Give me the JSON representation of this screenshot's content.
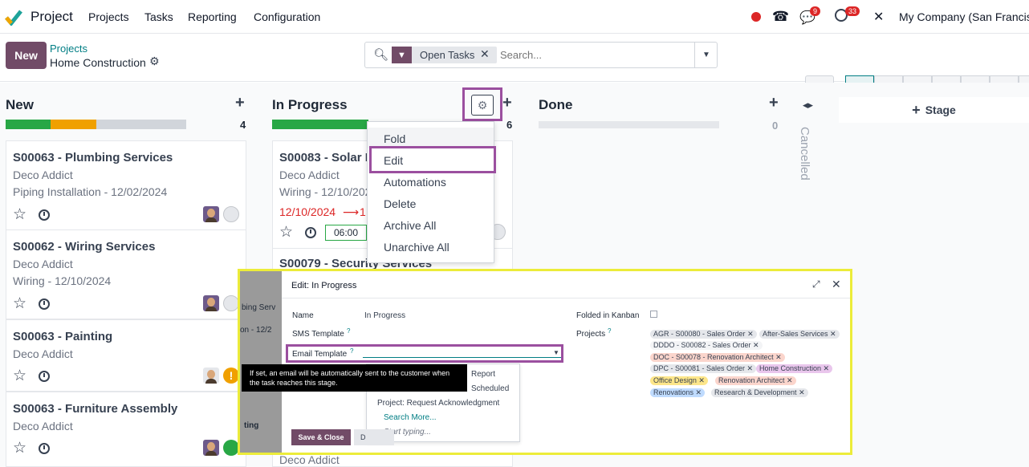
{
  "nav": {
    "app_name": "Project",
    "menu": [
      "Projects",
      "Tasks",
      "Reporting",
      "Configuration"
    ],
    "chat_count": "9",
    "activity_count": "33",
    "company": "My Company (San Francisco)"
  },
  "control_panel": {
    "new_label": "New",
    "breadcrumb_parent": "Projects",
    "breadcrumb_current": "Home Construction",
    "filter_facet": "Open Tasks",
    "search_placeholder": "Search..."
  },
  "columns": [
    {
      "name": "New",
      "count": "4"
    },
    {
      "name": "In Progress",
      "count": "6"
    },
    {
      "name": "Done",
      "count": "0"
    },
    {
      "name": "Cancelled"
    }
  ],
  "add_stage_label": "Stage",
  "new_cards": [
    {
      "title": "S00063 - Plumbing Services",
      "customer": "Deco Addict",
      "detail": "Piping Installation - 12/02/2024"
    },
    {
      "title": "S00062 - Wiring Services",
      "customer": "Deco Addict",
      "detail": "Wiring - 12/10/2024"
    },
    {
      "title": "S00063 - Painting",
      "customer": "Deco Addict",
      "detail": ""
    },
    {
      "title": "S00063 - Furniture Assembly",
      "customer": "Deco Addict",
      "detail": ""
    }
  ],
  "progress_cards": [
    {
      "title": "S00083 - Solar In",
      "customer": "Deco Addict",
      "detail": "Wiring - 12/10/202",
      "date_from": "12/10/2024",
      "arrow": "⟶",
      "date_to": "1",
      "time": "06:00"
    },
    {
      "title": "S00079 - Security Services",
      "customer": "Deco Addict"
    }
  ],
  "stage_menu": [
    "Fold",
    "Edit",
    "Automations",
    "Delete",
    "Archive All",
    "Unarchive All"
  ],
  "dialog": {
    "title": "Edit: In Progress",
    "name_label": "Name",
    "name_value": "In Progress",
    "sms_label": "SMS Template",
    "email_label": "Email Template",
    "folded_label": "Folded in Kanban",
    "projects_label": "Projects",
    "tooltip": "If set, an email will be automatically sent to the customer when the task reaches this stage.",
    "dropdown": [
      "Report",
      "Scheduled",
      "Project: Request Acknowledgment",
      "Search More...",
      "Start typing..."
    ],
    "save_label": "Save & Close",
    "discard_label": "D",
    "bg_fragments": [
      "bing Serv",
      "on - 12/2",
      "ting"
    ],
    "projects": [
      {
        "label": "AGR - S00080 - Sales Order",
        "color": "#e5e7eb"
      },
      {
        "label": "After-Sales Services",
        "color": "#e5e7eb"
      },
      {
        "label": "DDDO - S00082 - Sales Order",
        "color": "#f3f4f6"
      },
      {
        "label": "DOC - S00078 - Renovation Architect",
        "color": "#fbd5cc"
      },
      {
        "label": "DPC - S00081 - Sales Order",
        "color": "#e5e7eb"
      },
      {
        "label": "Home Construction",
        "color": "#e9c6ec"
      },
      {
        "label": "Office Design",
        "color": "#fde68a"
      },
      {
        "label": "Renovation Architect",
        "color": "#fbd5cc"
      },
      {
        "label": "Renovations",
        "color": "#bfdbfe"
      },
      {
        "label": "Research & Development",
        "color": "#e5e7eb"
      }
    ]
  },
  "colors": {
    "primary": "#714b67",
    "teal": "#017e84",
    "highlight": "#9b4f9f",
    "dialog_border": "#ecec3a"
  }
}
